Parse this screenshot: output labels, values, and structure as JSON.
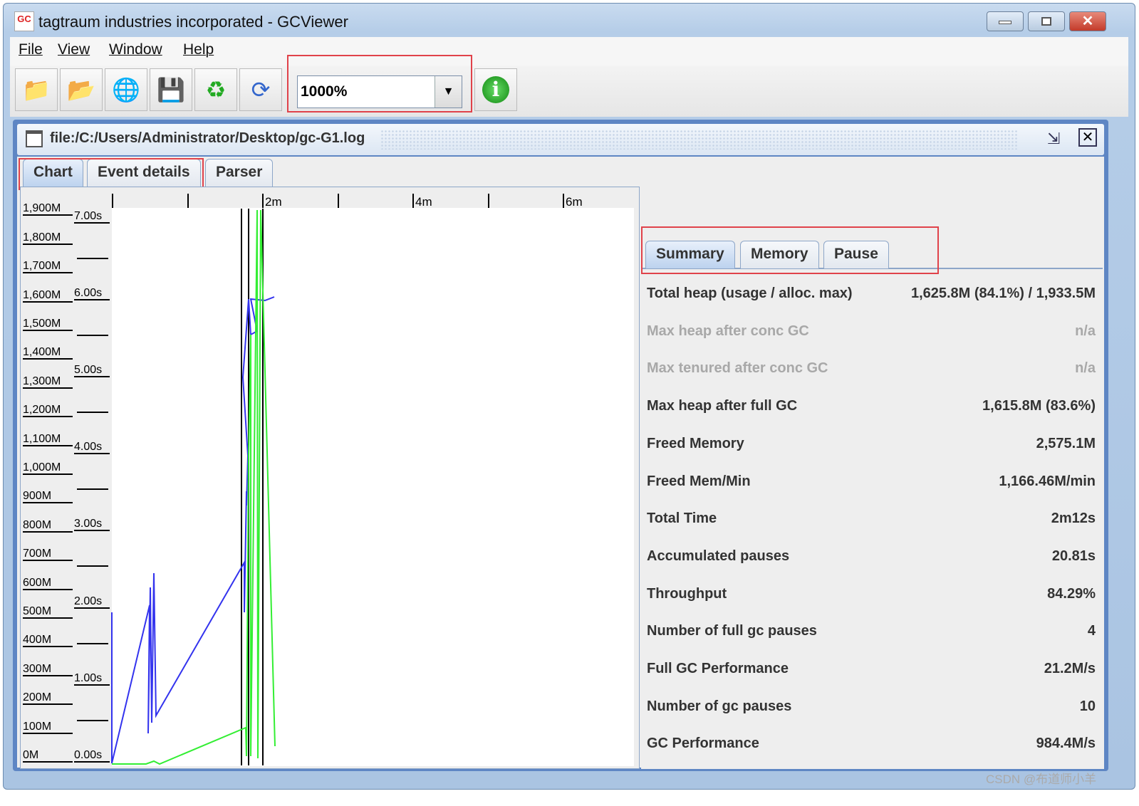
{
  "window": {
    "title": "tagtraum industries incorporated - GCViewer",
    "logo": "GC VIEWER"
  },
  "menu": [
    "File",
    "View",
    "Window",
    "Help"
  ],
  "toolbar": {
    "icons": [
      "open-file-icon",
      "open-recent-icon",
      "open-url-icon",
      "save-icon",
      "refresh-icon",
      "watch-icon"
    ],
    "zoom_value": "1000%",
    "info_icon": "info-icon"
  },
  "document": {
    "title": "file:/C:/Users/Administrator/Desktop/gc-G1.log"
  },
  "tabs": [
    "Chart",
    "Event details",
    "Parser"
  ],
  "chart": {
    "x_ticks": [
      "2m",
      "4m",
      "6m"
    ],
    "memory_ticks": [
      "1,900M",
      "1,800M",
      "1,700M",
      "1,600M",
      "1,500M",
      "1,400M",
      "1,300M",
      "1,200M",
      "1,100M",
      "1,000M",
      "900M",
      "800M",
      "700M",
      "600M",
      "500M",
      "400M",
      "300M",
      "200M",
      "100M",
      "0M"
    ],
    "time_ticks": [
      "7.00s",
      "6.00s",
      "5.00s",
      "4.00s",
      "3.00s",
      "2.00s",
      "1.00s",
      "0.00s"
    ],
    "colors": {
      "heap": "#3333ee",
      "gc": "#33ee33",
      "fullgc": "#000000"
    }
  },
  "summary": {
    "tabs": [
      "Summary",
      "Memory",
      "Pause"
    ],
    "rows": [
      {
        "label": "Total heap (usage / alloc. max)",
        "value": "1,625.8M (84.1%) / 1,933.5M",
        "enabled": true
      },
      {
        "label": "Max heap after conc GC",
        "value": "n/a",
        "enabled": false
      },
      {
        "label": "Max tenured after conc GC",
        "value": "n/a",
        "enabled": false
      },
      {
        "label": "Max heap after full GC",
        "value": "1,615.8M (83.6%)",
        "enabled": true
      },
      {
        "label": "Freed Memory",
        "value": "2,575.1M",
        "enabled": true
      },
      {
        "label": "Freed Mem/Min",
        "value": "1,166.46M/min",
        "enabled": true
      },
      {
        "label": "Total Time",
        "value": "2m12s",
        "enabled": true
      },
      {
        "label": "Accumulated pauses",
        "value": "20.81s",
        "enabled": true
      },
      {
        "label": "Throughput",
        "value": "84.29%",
        "enabled": true
      },
      {
        "label": "Number of full gc pauses",
        "value": "4",
        "enabled": true
      },
      {
        "label": "Full GC Performance",
        "value": "21.2M/s",
        "enabled": true
      },
      {
        "label": "Number of gc pauses",
        "value": "10",
        "enabled": true
      },
      {
        "label": "GC Performance",
        "value": "984.4M/s",
        "enabled": true
      }
    ]
  },
  "watermark": "CSDN @布道师小羊"
}
